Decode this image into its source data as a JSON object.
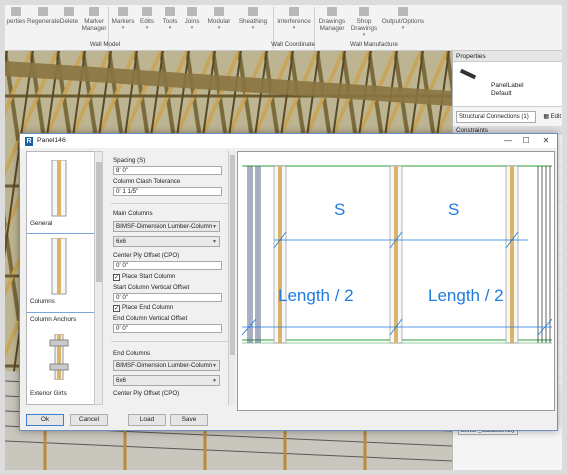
{
  "ribbon": {
    "buttons": [
      {
        "label": "perties",
        "icon": "properties-icon"
      },
      {
        "label": "Regenerate",
        "icon": "regenerate-icon"
      },
      {
        "label": "Delete",
        "icon": "delete-icon"
      },
      {
        "label": "Marker Manager",
        "icon": "marker-manager-icon"
      },
      {
        "label": "Markers",
        "icon": "markers-icon"
      },
      {
        "label": "Edits",
        "icon": "edits-icon"
      },
      {
        "label": "Tools",
        "icon": "tools-icon"
      },
      {
        "label": "Joins",
        "icon": "joins-icon"
      },
      {
        "label": "Modular",
        "icon": "modular-icon"
      },
      {
        "label": "Sheathing",
        "icon": "sheathing-icon"
      },
      {
        "label": "Interference",
        "icon": "interference-icon"
      },
      {
        "label": "Drawings Manager",
        "icon": "drawings-manager-icon"
      },
      {
        "label": "Shop Drawings",
        "icon": "shop-drawings-icon"
      },
      {
        "label": "Output/Options",
        "icon": "output-options-icon"
      }
    ],
    "panels": {
      "wall_model": "Wall Model",
      "wall_coordinate": "Wall Coordinate",
      "wall_manufacture": "Wall Manufacture"
    }
  },
  "properties": {
    "title": "Properties",
    "type_name": "PanelLabel",
    "type_sub": "Default",
    "selector": "Structural Connections (1)",
    "edit_label": "Edit",
    "section": "Constraints",
    "bottom_value": "BIMSF_Subassembly"
  },
  "dialog": {
    "app_letter": "R",
    "title": "Panel146",
    "sidebar": [
      {
        "label": "General"
      },
      {
        "label": "Columns"
      },
      {
        "label": "Column Anchors"
      },
      {
        "label": "Exterior Girts"
      }
    ],
    "form": {
      "spacing_label": "Spacing (S)",
      "spacing_value": "8' 0\"",
      "clash_label": "Column Clash Tolerance",
      "clash_value": "0' 1 1/5\"",
      "main_columns_label": "Main Columns",
      "main_column_type": "BIMSF-Dimension Lumber-Column",
      "main_column_size": "6x6",
      "center_ply_label": "Center Ply Offset (CPO)",
      "center_ply_value": "0' 0\"",
      "place_start_label": "Place Start Column",
      "start_offset_label": "Start Column Vertical Offset",
      "start_offset_value": "0' 0\"",
      "place_end_label": "Place End Column",
      "end_offset_label": "End Column Vertical Offset",
      "end_offset_value": "0' 0\"",
      "end_columns_label": "End Columns",
      "end_column_type": "BIMSF-Dimension Lumber-Column",
      "end_column_size": "6x6",
      "cut_label": "Center Ply Offset (CPO)"
    },
    "preview": {
      "s_label_1": "S",
      "s_label_2": "S",
      "length_label_1": "Length / 2",
      "length_label_2": "Length / 2"
    },
    "buttons": {
      "ok": "Ok",
      "cancel": "Cancel",
      "load": "Load",
      "save": "Save"
    }
  },
  "colors": {
    "dimension_blue": "#1e7be0",
    "timber": "#d9b46a",
    "dialog_border": "#6b8ec3"
  }
}
